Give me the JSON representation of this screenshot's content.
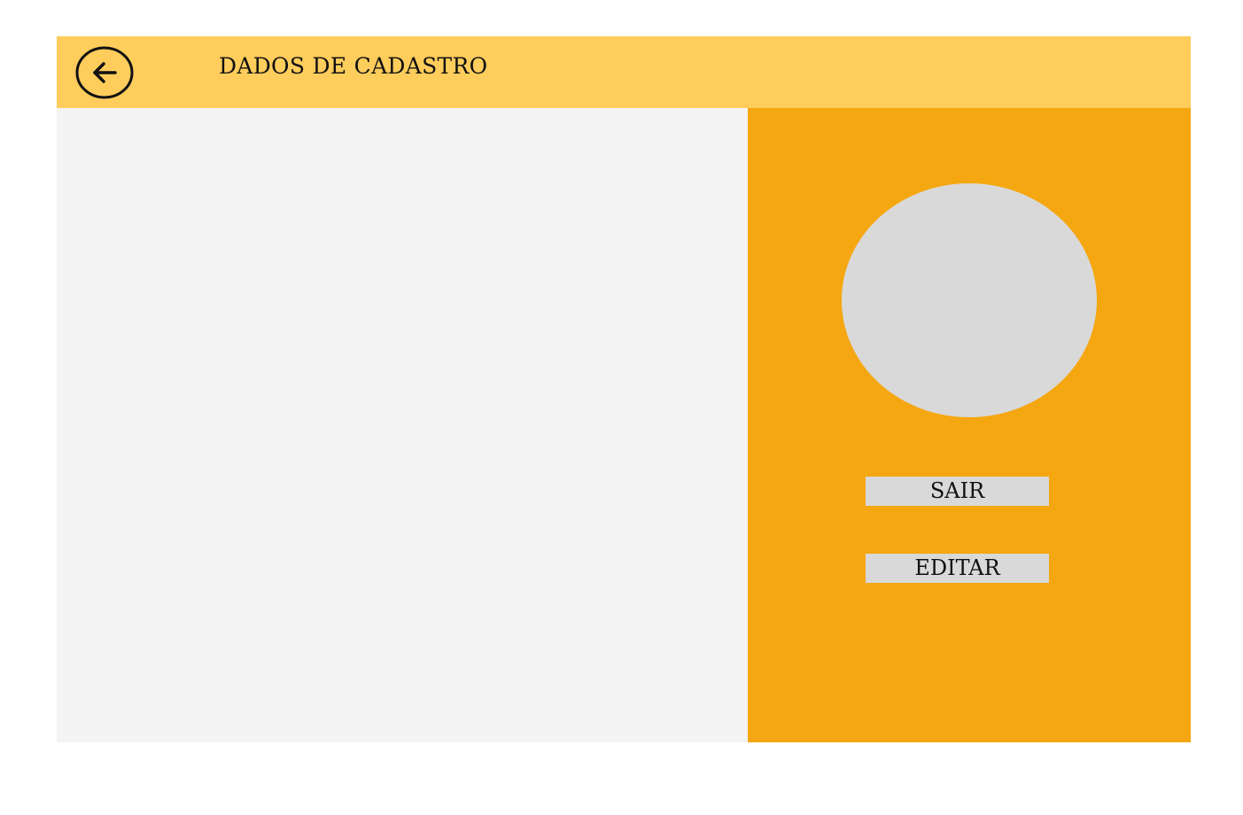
{
  "header": {
    "title": "DADOS DE CADASTRO",
    "back_icon": "arrow-left-circle-icon",
    "background_color": "#ffcd5c"
  },
  "content_panel": {
    "background_color": "#f4f4f4"
  },
  "side_panel": {
    "background_color": "#f5a711",
    "avatar_color": "#d9d9d9",
    "buttons": {
      "sair_label": "SAIR",
      "editar_label": "EDITAR"
    }
  }
}
